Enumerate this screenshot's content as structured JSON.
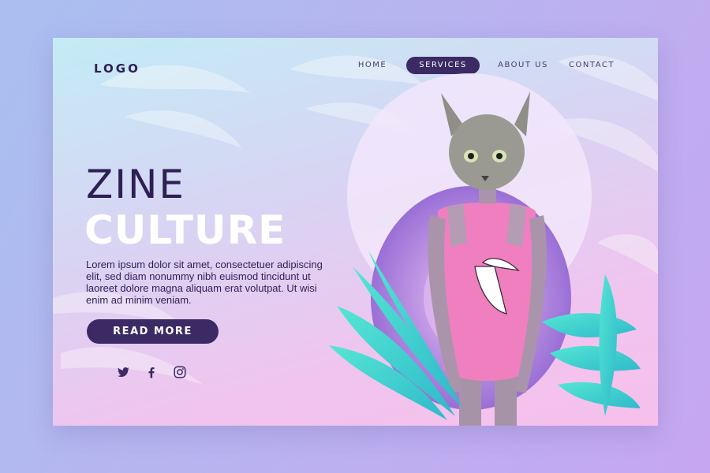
{
  "header": {
    "logo": "LOGO",
    "nav": [
      {
        "label": "HOME",
        "active": false
      },
      {
        "label": "SERVICES",
        "active": true
      },
      {
        "label": "ABOUT US",
        "active": false
      },
      {
        "label": "CONTACT",
        "active": false
      }
    ]
  },
  "hero": {
    "title_line1": "ZINE",
    "title_line2": "CULTURE",
    "body": "Lorem ipsum dolor sit amet, consectetuer adipiscing elit, sed diam nonummy nibh euismod tincidunt ut laoreet dolore magna aliquam erat volutpat. Ut wisi enim ad minim veniam.",
    "cta_label": "READ MORE"
  },
  "social": [
    "twitter-icon",
    "facebook-icon",
    "instagram-icon"
  ],
  "colors": {
    "accent": "#3b2a64",
    "title_dark": "#2e1f55",
    "title_light": "#ffffff",
    "leaf_teal": "#3fd8c8"
  }
}
